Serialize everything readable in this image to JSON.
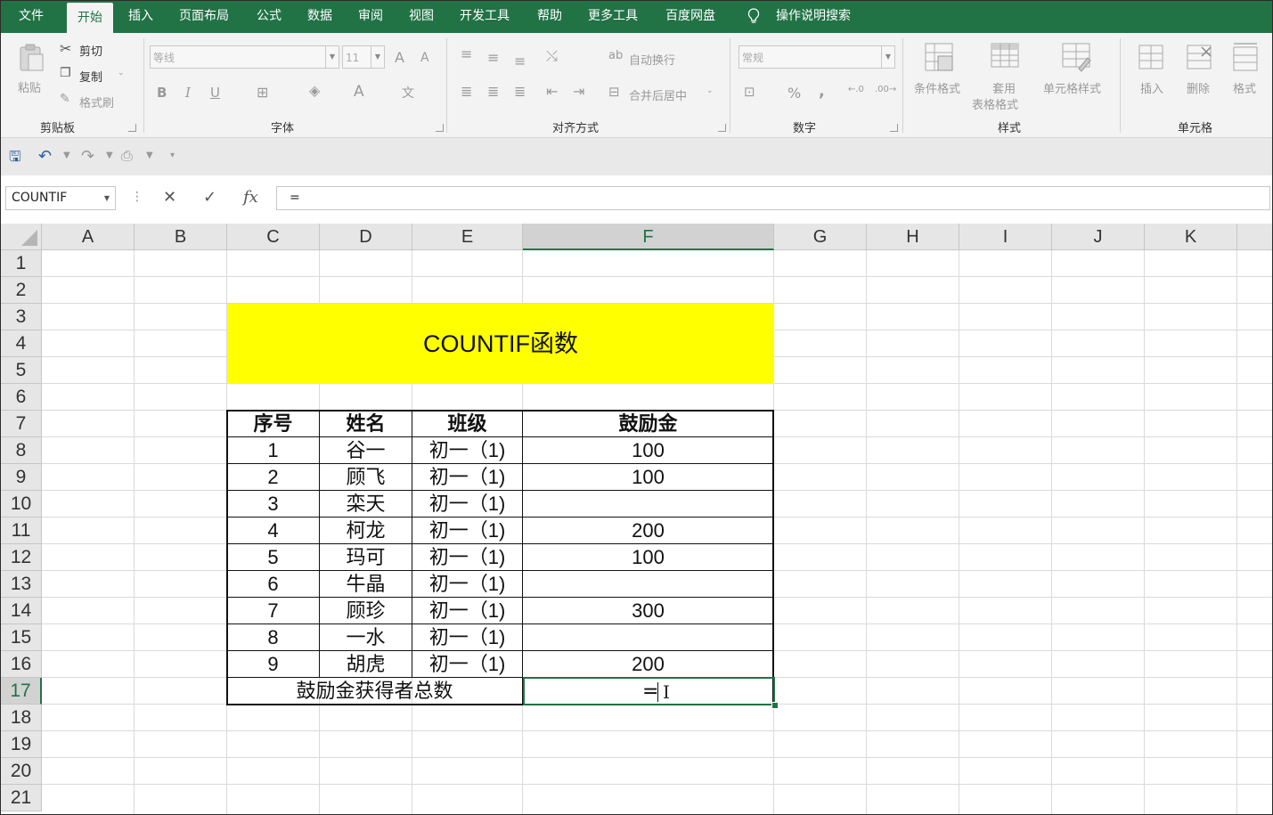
{
  "menu": {
    "items": [
      "文件",
      "开始",
      "插入",
      "页面布局",
      "公式",
      "数据",
      "审阅",
      "视图",
      "开发工具",
      "帮助",
      "更多工具",
      "百度网盘"
    ],
    "active": "开始",
    "search_label": "操作说明搜索"
  },
  "ribbon": {
    "clipboard": {
      "paste": "粘贴",
      "cut": "剪切",
      "copy": "复制",
      "format_painter": "格式刷",
      "group": "剪贴板"
    },
    "font": {
      "name": "等线",
      "size": "11",
      "group": "字体",
      "bold": "B",
      "italic": "I",
      "underline": "U",
      "grow": "A",
      "shrink": "A"
    },
    "alignment": {
      "wrap": "自动换行",
      "merge": "合并后居中",
      "group": "对齐方式"
    },
    "number": {
      "format": "常规",
      "percent": "%",
      "comma": ",",
      "group": "数字"
    },
    "styles": {
      "conditional": "条件格式",
      "table_line1": "套用",
      "table_line2": "表格格式",
      "cell_styles": "单元格样式",
      "group": "样式"
    },
    "cells": {
      "insert": "插入",
      "delete": "删除",
      "format": "格式",
      "group": "单元格"
    }
  },
  "formula_bar": {
    "name_box": "COUNTIF",
    "cancel": "✕",
    "enter": "✓",
    "fx": "fx",
    "content": "="
  },
  "columns": [
    "A",
    "B",
    "C",
    "D",
    "E",
    "F",
    "G",
    "H",
    "I",
    "J",
    "K"
  ],
  "rows": [
    "1",
    "2",
    "3",
    "4",
    "5",
    "6",
    "7",
    "8",
    "9",
    "10",
    "11",
    "12",
    "13",
    "14",
    "15",
    "16",
    "17",
    "18",
    "19",
    "20",
    "21"
  ],
  "selected_column": "F",
  "selected_row": "17",
  "sheet": {
    "title": "COUNTIF函数",
    "headers": [
      "序号",
      "姓名",
      "班级",
      "鼓励金"
    ],
    "rows": [
      [
        "1",
        "谷一",
        "初一（1)",
        "100"
      ],
      [
        "2",
        "顾飞",
        "初一（1)",
        "100"
      ],
      [
        "3",
        "栾天",
        "初一（1)",
        ""
      ],
      [
        "4",
        "柯龙",
        "初一（1)",
        "200"
      ],
      [
        "5",
        "玛可",
        "初一（1)",
        "100"
      ],
      [
        "6",
        "牛晶",
        "初一（1)",
        ""
      ],
      [
        "7",
        "顾珍",
        "初一（1)",
        "300"
      ],
      [
        "8",
        "一水",
        "初一（1)",
        ""
      ],
      [
        "9",
        "胡虎",
        "初一（1)",
        "200"
      ]
    ],
    "total_label": "鼓励金获得者总数",
    "editing_value": "="
  }
}
